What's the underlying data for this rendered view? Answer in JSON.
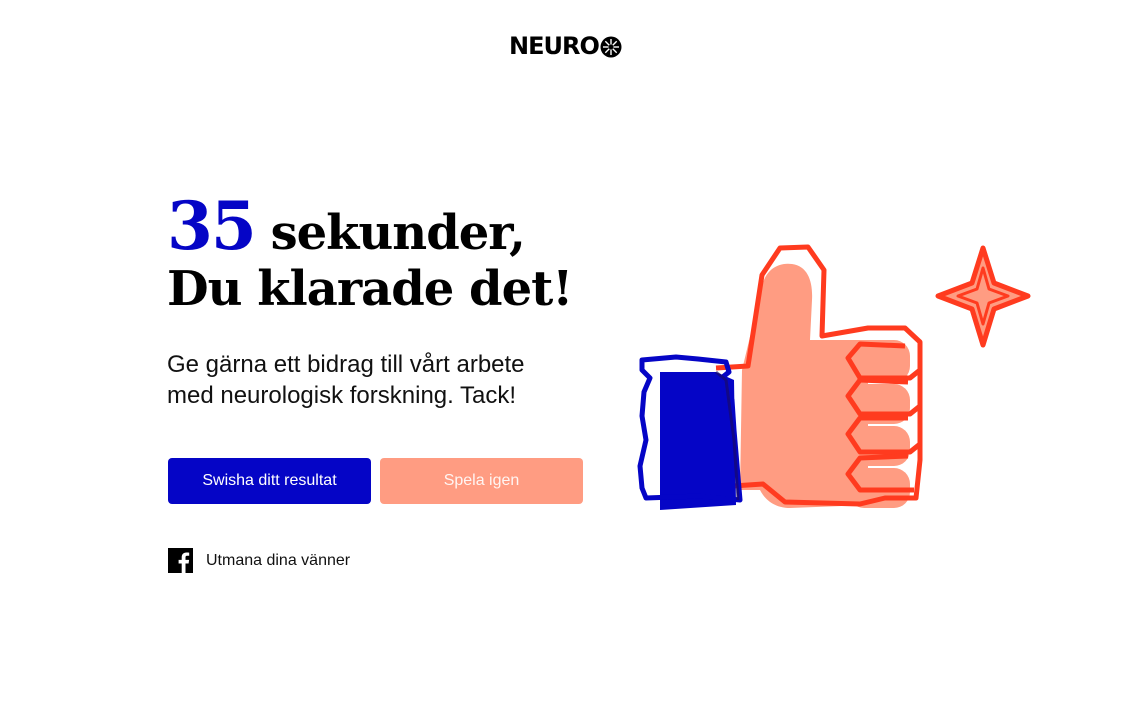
{
  "brand": {
    "logo_text": "NEURO"
  },
  "result": {
    "number": "35",
    "unit_text": "sekunder,",
    "message": "Du klarade det!"
  },
  "subtitle": "Ge gärna ett bidrag till vårt arbete med neurologisk forskning. Tack!",
  "buttons": {
    "primary_label": "Swisha ditt resultat",
    "secondary_label": "Spela igen"
  },
  "share": {
    "icon": "facebook-icon",
    "label": "Utmana dina vänner"
  },
  "illustration": {
    "icon": "thumbs-up-icon",
    "sparkle": "sparkle-icon"
  },
  "colors": {
    "accent_blue": "#0505c6",
    "coral": "#ff9c82",
    "red_outline": "#ff3b1f",
    "text": "#000000"
  }
}
